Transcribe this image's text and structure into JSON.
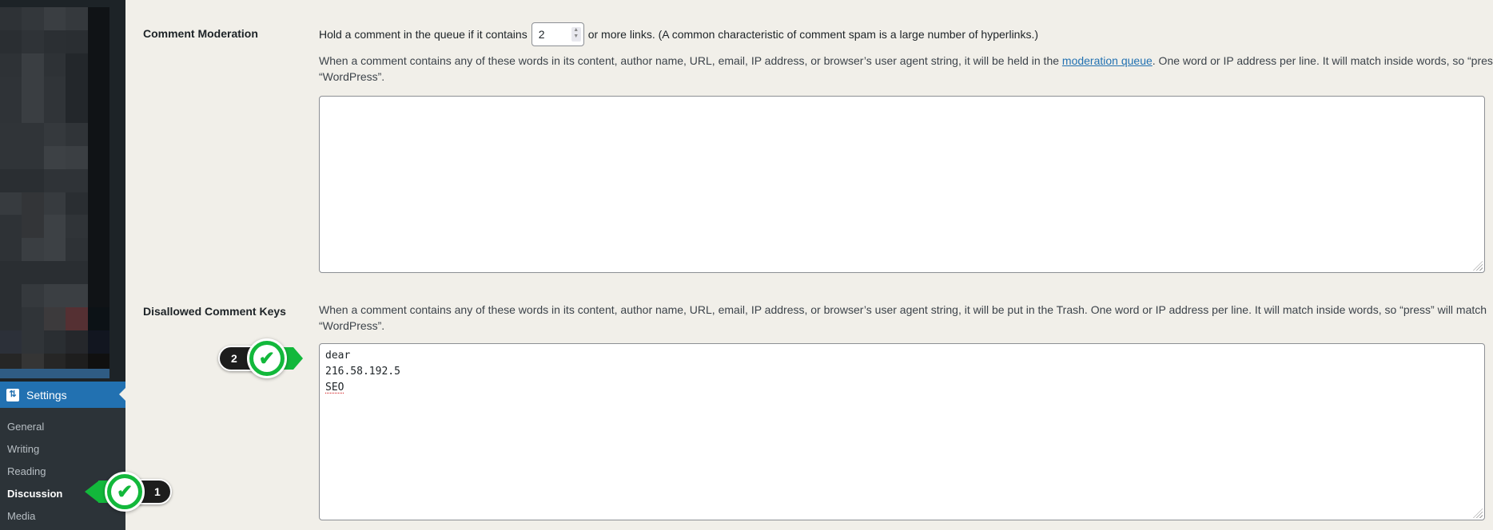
{
  "sidebar": {
    "pixel_colors": [
      "#2e3236",
      "#33373b",
      "#3a3e42",
      "#35393d",
      "#101316",
      "#2a2e32",
      "#2f3337",
      "#2b2f33",
      "#2a2e32",
      "#101316",
      "#2e3236",
      "#3a3e42",
      "#2e3236",
      "#23272b",
      "#101316",
      "#2f3337",
      "#3a3e42",
      "#303438",
      "#23272b",
      "#101316",
      "#2f3337",
      "#3a3e42",
      "#303438",
      "#23272b",
      "#101316",
      "#303438",
      "#303438",
      "#35393d",
      "#303438",
      "#101316",
      "#303438",
      "#303438",
      "#3d4145",
      "#3b3f43",
      "#101316",
      "#2a2e32",
      "#2a2e32",
      "#2f3337",
      "#2f3337",
      "#101316",
      "#373b3f",
      "#333538",
      "#373b3f",
      "#2a2e32",
      "#101316",
      "#2e3236",
      "#333538",
      "#3d4145",
      "#303438",
      "#101316",
      "#2e3236",
      "#3a3e42",
      "#3d4145",
      "#2e3236",
      "#101316",
      "#2a2e32",
      "#2a2e32",
      "#2a2e32",
      "#2a2e32",
      "#101316",
      "#2a2e32",
      "#35393d",
      "#3b3f43",
      "#3b3f43",
      "#101316",
      "#2a2e32",
      "#303438",
      "#3c3a3c",
      "#553033",
      "#0c1216",
      "#2c3039",
      "#303438",
      "#2a2e32",
      "#25272b",
      "#121620",
      "#262626",
      "#353535",
      "#262626",
      "#1e1e1e",
      "#101010"
    ],
    "settings": {
      "label": "Settings",
      "icon": "sliders-icon",
      "icon_glyph": "⇅"
    },
    "submenu": [
      {
        "label": "General",
        "current": false
      },
      {
        "label": "Writing",
        "current": false
      },
      {
        "label": "Reading",
        "current": false
      },
      {
        "label": "Discussion",
        "current": true
      },
      {
        "label": "Media",
        "current": false
      }
    ]
  },
  "comment_moderation": {
    "label": "Comment Moderation",
    "hold_prefix": "Hold a comment in the queue if it contains",
    "links_value": "2",
    "hold_suffix": "or more links. (A common characteristic of comment spam is a large number of hyperlinks.)",
    "desc_before_link": "When a comment contains any of these words in its content, author name, URL, email, IP address, or browser’s user agent string, it will be held in the ",
    "desc_link": "moderation queue",
    "desc_after_link": ". One word or IP address per line. It will match inside words, so “press” will match “WordPress”.",
    "textarea_value": ""
  },
  "disallowed_keys": {
    "label": "Disallowed Comment Keys",
    "description": "When a comment contains any of these words in its content, author name, URL, email, IP address, or browser’s user agent string, it will be put in the Trash. One word or IP address per line. It will match inside words, so “press” will match “WordPress”.",
    "lines": [
      "dear",
      "216.58.192.5",
      "SEO"
    ]
  },
  "annotations": [
    {
      "number": "1",
      "icon": "checkmark-icon",
      "glyph": "✔"
    },
    {
      "number": "2",
      "icon": "checkmark-icon",
      "glyph": "✔"
    }
  ],
  "colors": {
    "accent": "#2271b1",
    "annotation_green": "#12b83b",
    "page_bg": "#f1efe9",
    "sidebar_bg": "#1d2327"
  }
}
